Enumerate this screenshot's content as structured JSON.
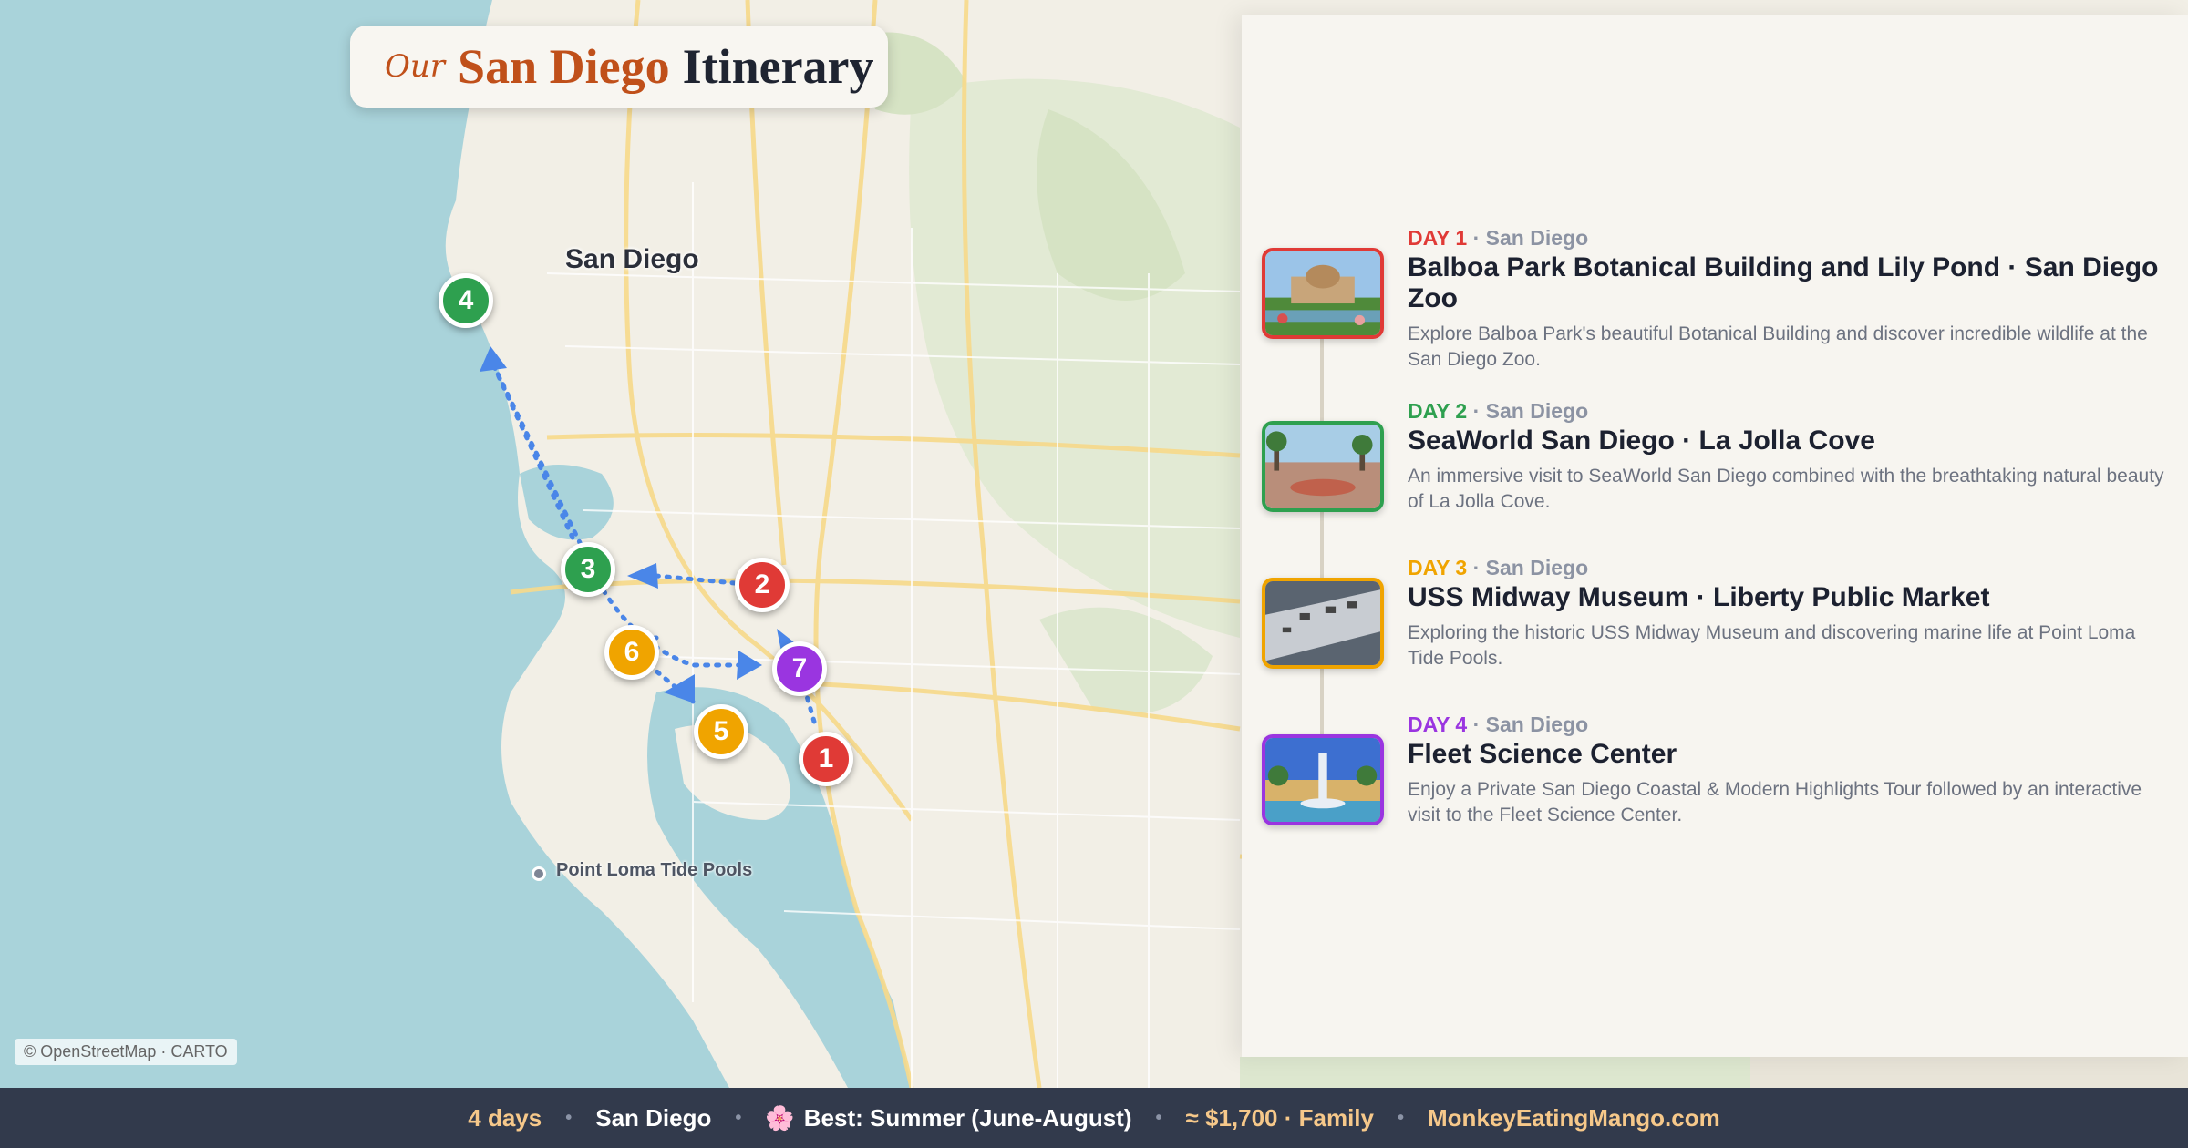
{
  "title": {
    "prefix": "Our",
    "city": "San Diego",
    "suffix": "Itinerary"
  },
  "map": {
    "city_label": "San Diego",
    "poi_label": "Point Loma Tide Pools",
    "attribution": "© OpenStreetMap · CARTO",
    "markers": [
      {
        "number": "1",
        "color": "#e03a36"
      },
      {
        "number": "2",
        "color": "#e03a36"
      },
      {
        "number": "3",
        "color": "#2ea04f"
      },
      {
        "number": "4",
        "color": "#2ea04f"
      },
      {
        "number": "5",
        "color": "#f0a400"
      },
      {
        "number": "6",
        "color": "#f0a400"
      },
      {
        "number": "7",
        "color": "#9a35e0"
      }
    ]
  },
  "days": [
    {
      "day_label": "DAY 1",
      "location": "· San Diego",
      "color": "#e03a36",
      "title": "Balboa Park Botanical Building and Lily Pond · San Diego Zoo",
      "description": "Explore Balboa Park's beautiful Botanical Building and discover incredible wildlife at the San Diego Zoo."
    },
    {
      "day_label": "DAY 2",
      "location": "· San Diego",
      "color": "#2ea04f",
      "title": "SeaWorld San Diego · La Jolla Cove",
      "description": "An immersive visit to SeaWorld San Diego combined with the breathtaking natural beauty of La Jolla Cove."
    },
    {
      "day_label": "DAY 3",
      "location": "· San Diego",
      "color": "#f0a400",
      "title": "USS Midway Museum · Liberty Public Market",
      "description": "Exploring the historic USS Midway Museum and discovering marine life at Point Loma Tide Pools."
    },
    {
      "day_label": "DAY 4",
      "location": "· San Diego",
      "color": "#9a35e0",
      "title": "Fleet Science Center",
      "description": "Enjoy a Private San Diego Coastal & Modern Highlights Tour followed by an interactive visit to the Fleet Science Center."
    }
  ],
  "footer": {
    "duration": "4 days",
    "city": "San Diego",
    "season_icon": "🌸",
    "season": "Best: Summer (June-August)",
    "budget": "≈ $1,700 · Family",
    "site": "MonkeyEatingMango.com"
  }
}
